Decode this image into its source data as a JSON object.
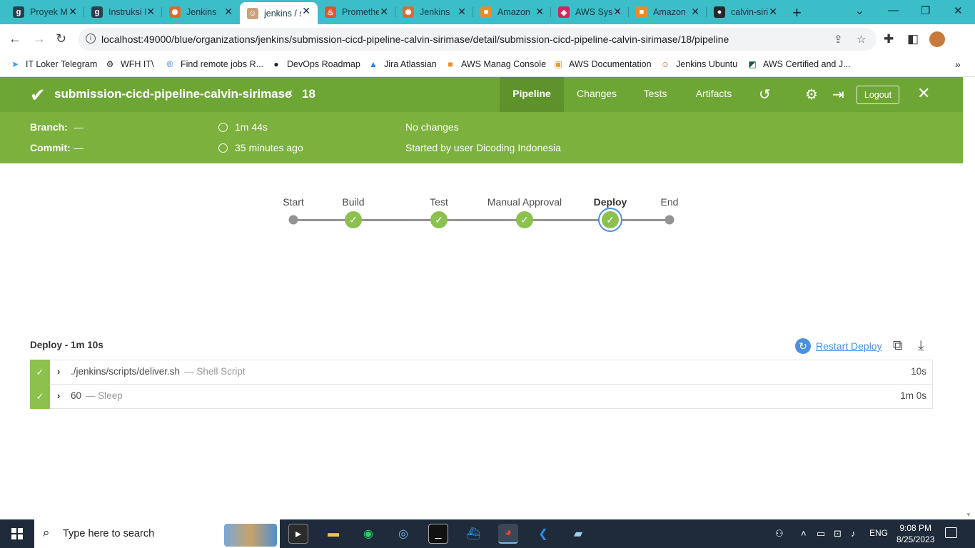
{
  "browser": {
    "tabs": [
      {
        "title": "Proyek Membangun CI/CD",
        "favicon": "dicoding-icon",
        "color": "#2d3e50",
        "letter": "g"
      },
      {
        "title": "Instruksi Proyek",
        "favicon": "dicoding-icon",
        "color": "#2d3e50",
        "letter": "g"
      },
      {
        "title": "Jenkins",
        "favicon": "jenkins-icon",
        "color": "#e06a2c",
        "letter": "✺"
      },
      {
        "title": "jenkins / submission",
        "favicon": "jenkins-butler-icon",
        "color": "#c9a27a",
        "letter": "☺"
      },
      {
        "title": "Prometheus",
        "favicon": "prometheus-icon",
        "color": "#e6522c",
        "letter": "♨"
      },
      {
        "title": "Jenkins",
        "favicon": "jenkins-icon",
        "color": "#e06a2c",
        "letter": "✺"
      },
      {
        "title": "Amazon",
        "favicon": "aws-icon",
        "color": "#f08a24",
        "letter": "■"
      },
      {
        "title": "AWS Systems",
        "favicon": "aws-systems-icon",
        "color": "#d6245a",
        "letter": "◈"
      },
      {
        "title": "Amazon",
        "favicon": "aws-icon",
        "color": "#f08a24",
        "letter": "■"
      },
      {
        "title": "calvin-sirimase",
        "favicon": "github-icon",
        "color": "#24292e",
        "letter": "●"
      }
    ],
    "url": "localhost:49000/blue/organizations/jenkins/submission-cicd-pipeline-calvin-sirimase/detail/submission-cicd-pipeline-calvin-sirimase/18/pipeline",
    "bookmarks": [
      {
        "label": "IT Loker Telegram",
        "icon": "telegram-icon"
      },
      {
        "label": "WFH IT\\",
        "icon": "gear-icon"
      },
      {
        "label": "Find remote jobs R...",
        "icon": "remote-icon"
      },
      {
        "label": "DevOps Roadmap",
        "icon": "github-icon"
      },
      {
        "label": "Jira Atlassian",
        "icon": "jira-icon"
      },
      {
        "label": "AWS Manag Console",
        "icon": "aws-icon"
      },
      {
        "label": "AWS Documentation",
        "icon": "aws-doc-icon"
      },
      {
        "label": "Jenkins Ubuntu",
        "icon": "jenkins-butler-icon"
      },
      {
        "label": "AWS Certified and J...",
        "icon": "certified-icon"
      }
    ]
  },
  "jenkins": {
    "pipeline_name": "submission-cicd-pipeline-calvin-sirimase",
    "run_number": "18",
    "nav": {
      "pipeline": "Pipeline",
      "changes": "Changes",
      "tests": "Tests",
      "artifacts": "Artifacts",
      "logout": "Logout"
    },
    "summary": {
      "branch_label": "Branch:",
      "branch_value": "—",
      "commit_label": "Commit:",
      "commit_value": "—",
      "duration": "1m 44s",
      "started_ago": "35 minutes ago",
      "changes": "No changes",
      "started_by": "Started by user Dicoding Indonesia"
    },
    "stages": [
      {
        "name": "Start",
        "status": "start"
      },
      {
        "name": "Build",
        "status": "success"
      },
      {
        "name": "Test",
        "status": "success"
      },
      {
        "name": "Manual Approval",
        "status": "success"
      },
      {
        "name": "Deploy",
        "status": "success",
        "selected": true
      },
      {
        "name": "End",
        "status": "end"
      }
    ],
    "stage_detail": {
      "title": "Deploy - 1m 10s",
      "restart_label": "Restart Deploy",
      "steps": [
        {
          "name": "./jenkins/scripts/deliver.sh",
          "type": "— Shell Script",
          "duration": "10s"
        },
        {
          "name": "60",
          "type": "— Sleep",
          "duration": "1m 0s"
        }
      ]
    },
    "colors": {
      "header": "#6ea635",
      "subheader": "#7bb13c",
      "success": "#8cc04f",
      "selected_ring": "#4a90e2"
    }
  },
  "taskbar": {
    "search_placeholder": "Type here to search",
    "language": "ENG",
    "time": "9:08 PM",
    "date": "8/25/2023"
  }
}
